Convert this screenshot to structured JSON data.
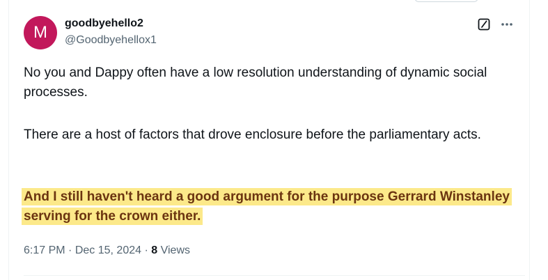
{
  "tweet": {
    "avatar_letter": "M",
    "avatar_color": "#c2185b",
    "display_name": "goodbyehello2",
    "handle": "@Goodbyehellox1",
    "paragraph_1": "No you and Dappy often have a low resolution understanding of dynamic social processes.",
    "paragraph_2": "There are a host of factors that drove enclosure before the parliamentary acts.",
    "paragraph_3": "And I still haven't heard a good argument for the purpose Gerrard Winstanley serving for the crown either.",
    "highlight_color": "#fce98a",
    "time": "6:17 PM",
    "date": "Dec 15, 2024",
    "separator": "·",
    "views_count": "8",
    "views_label": "Views"
  },
  "icons": {
    "grok": "grok-icon",
    "more": "more-icon"
  }
}
